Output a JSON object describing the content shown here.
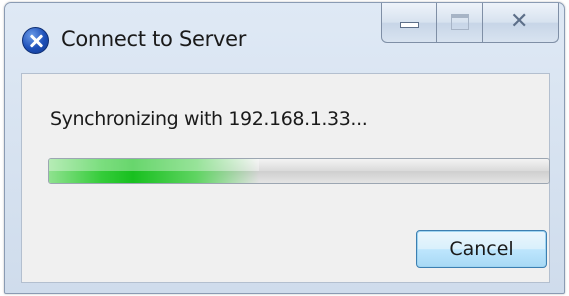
{
  "window": {
    "title": "Connect to Server",
    "icon": "app-icon"
  },
  "caption_buttons": {
    "minimize_icon": "minimize-icon",
    "maximize_icon": "maximize-icon",
    "close_icon": "close-icon",
    "close_glyph": "✕"
  },
  "dialog": {
    "message": "Synchronizing with 192.168.1.33...",
    "progress": 0.42,
    "progress_color": "#18c01f",
    "cancel_label": "Cancel"
  }
}
